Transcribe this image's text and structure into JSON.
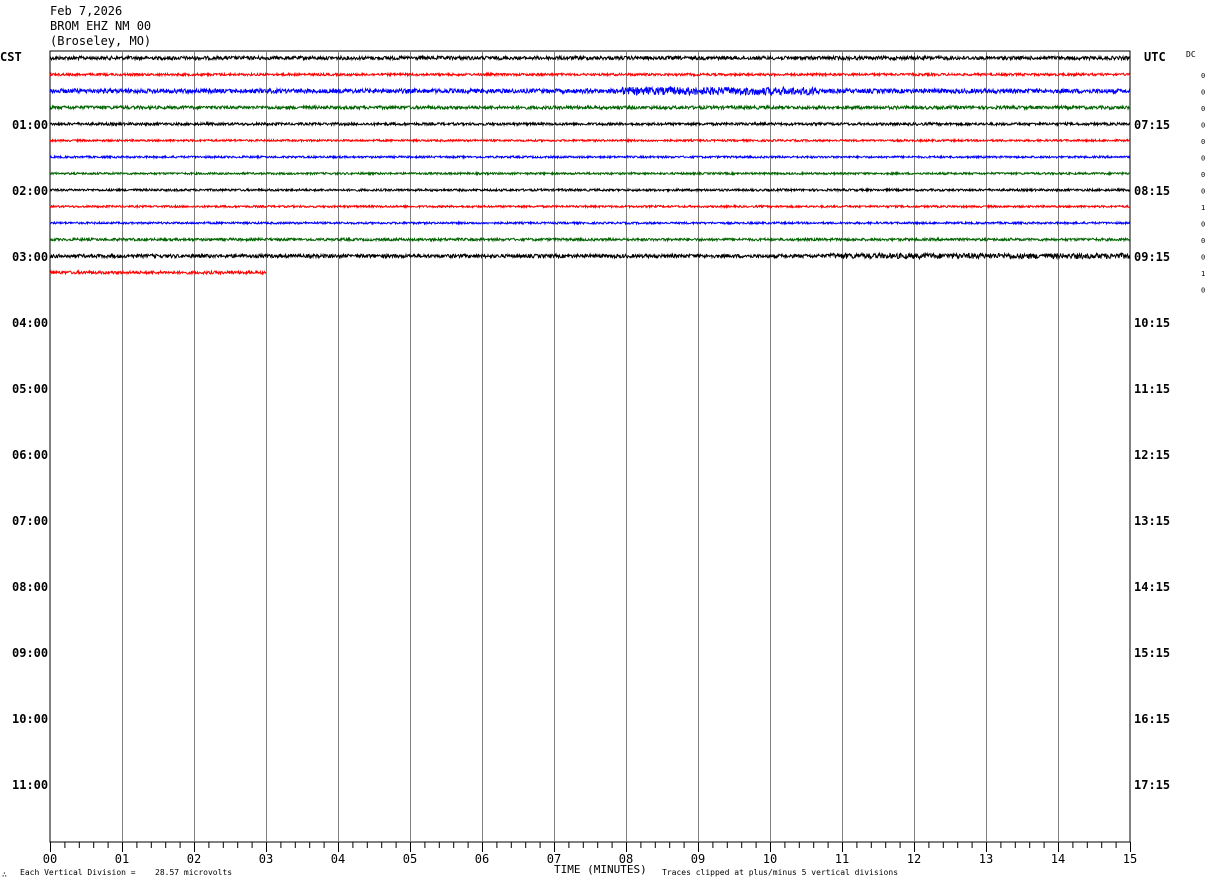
{
  "header": {
    "date": "Feb 7,2026",
    "station": "BROM EHZ NM 00",
    "location": "(Broseley, MO)"
  },
  "left_tz": "CST",
  "right_tz": "UTC",
  "dc_label": "DC",
  "footer": {
    "corner_mark": "∴",
    "division_label": "Each Vertical Division =",
    "division_value": "28.57 microvolts",
    "xlabel": "TIME (MINUTES)",
    "clip_note": "Traces clipped at plus/minus 5 vertical divisions"
  },
  "chart_data": {
    "type": "line",
    "title": "BROM EHZ NM 00",
    "xlabel": "TIME (MINUTES)",
    "ylabel": "",
    "xlim": [
      0,
      15
    ],
    "x_ticks": [
      "00",
      "01",
      "02",
      "03",
      "04",
      "05",
      "06",
      "07",
      "08",
      "09",
      "10",
      "11",
      "12",
      "13",
      "14",
      "15"
    ],
    "left_hour_labels": [
      "01:00",
      "02:00",
      "03:00",
      "04:00",
      "05:00",
      "06:00",
      "07:00",
      "08:00",
      "09:00",
      "10:00",
      "11:00"
    ],
    "right_hour_labels": [
      "07:15",
      "08:15",
      "09:15",
      "10:15",
      "11:15",
      "12:15",
      "13:15",
      "14:15",
      "15:15",
      "16:15",
      "17:15"
    ],
    "trace_colors": [
      "#000000",
      "#ff0000",
      "#0000ff",
      "#006400"
    ],
    "traces": [
      {
        "row": 0,
        "color": "#000000",
        "end_minute": 15,
        "amplitude": 1.8
      },
      {
        "row": 1,
        "color": "#ff0000",
        "end_minute": 15,
        "amplitude": 1.2
      },
      {
        "row": 2,
        "color": "#0000ff",
        "end_minute": 15,
        "amplitude": 2.2
      },
      {
        "row": 3,
        "color": "#006400",
        "end_minute": 15,
        "amplitude": 1.6
      },
      {
        "row": 4,
        "color": "#000000",
        "end_minute": 15,
        "amplitude": 1.3
      },
      {
        "row": 5,
        "color": "#ff0000",
        "end_minute": 15,
        "amplitude": 1.0
      },
      {
        "row": 6,
        "color": "#0000ff",
        "end_minute": 15,
        "amplitude": 1.0
      },
      {
        "row": 7,
        "color": "#006400",
        "end_minute": 15,
        "amplitude": 1.0
      },
      {
        "row": 8,
        "color": "#000000",
        "end_minute": 15,
        "amplitude": 1.1
      },
      {
        "row": 9,
        "color": "#ff0000",
        "end_minute": 15,
        "amplitude": 1.0
      },
      {
        "row": 10,
        "color": "#0000ff",
        "end_minute": 15,
        "amplitude": 1.0
      },
      {
        "row": 11,
        "color": "#006400",
        "end_minute": 15,
        "amplitude": 1.3
      },
      {
        "row": 12,
        "color": "#000000",
        "end_minute": 15,
        "amplitude": 1.8
      },
      {
        "row": 13,
        "color": "#ff0000",
        "end_minute": 3,
        "amplitude": 1.5
      }
    ],
    "dc_values": [
      "0",
      "0",
      "0",
      "0",
      "0",
      "0",
      "0",
      "0",
      "1",
      "0",
      "0",
      "0",
      "1",
      "0"
    ],
    "grid": true
  }
}
